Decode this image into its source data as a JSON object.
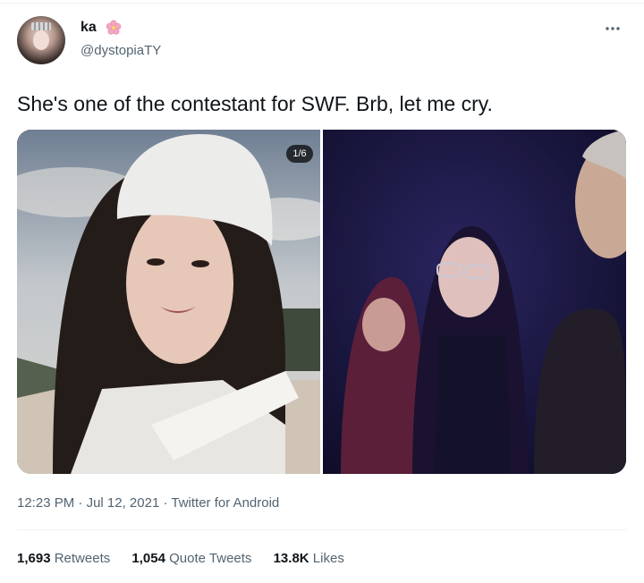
{
  "author": {
    "display_name": "ka",
    "handle": "@dystopiaTY",
    "badge_icon": "cherry-blossom-icon"
  },
  "tweet": {
    "text": "She's one of the contestant for SWF. Brb, let me cry.",
    "media_counter": "1/6"
  },
  "meta": {
    "time": "12:23 PM",
    "separator": "·",
    "date": "Jul 12, 2021",
    "source": "Twitter for Android"
  },
  "stats": {
    "retweets_count": "1,693",
    "retweets_label": "Retweets",
    "quotes_count": "1,054",
    "quotes_label": "Quote Tweets",
    "likes_count": "13.8K",
    "likes_label": "Likes"
  },
  "colors": {
    "text_primary": "#0f1419",
    "text_secondary": "#536471",
    "divider": "#eff3f4"
  }
}
